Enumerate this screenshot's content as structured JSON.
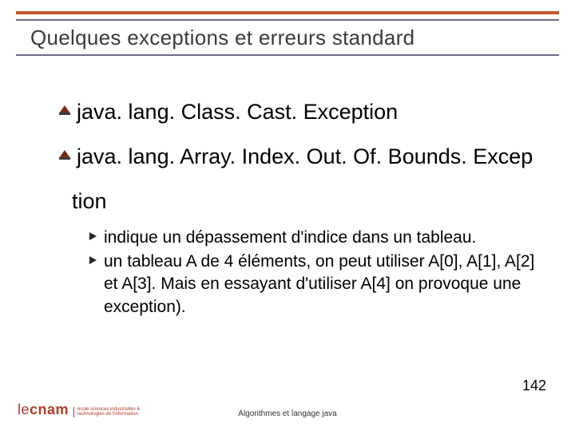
{
  "title": "Quelques exceptions et erreurs standard",
  "items": {
    "i0": "java. lang. Class. Cast. Exception",
    "i1a": "java. lang. Array. Index. Out. Of. Bounds. Excep",
    "i1b": "tion",
    "sub0": "indique un dépassement d'indice dans un tableau.",
    "sub1": "un tableau A de 4 éléments, on peut utiliser A[0], A[1], A[2] et A[3]. Mais en essayant d'utiliser A[4] on provoque une exception)."
  },
  "footer": "Algorithmes et langage java",
  "page": "142",
  "logo": {
    "le": "le",
    "cnam": "cnam",
    "line1": "école sciences industrielles &",
    "line2": "technologies de l'information"
  }
}
